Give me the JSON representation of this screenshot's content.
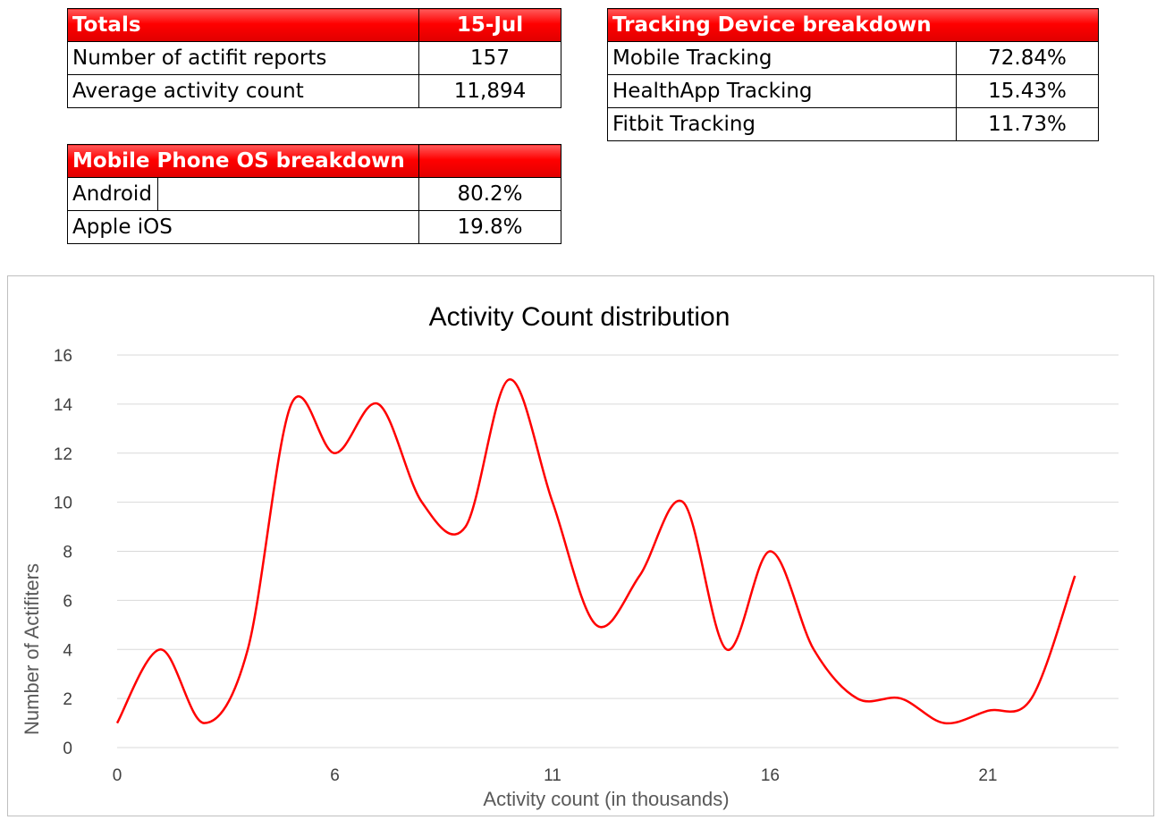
{
  "totals_table": {
    "header": [
      "Totals",
      "15-Jul"
    ],
    "rows": [
      [
        "Number of actifit reports",
        "157"
      ],
      [
        "Average activity count",
        "11,894"
      ]
    ]
  },
  "os_table": {
    "header": [
      "Mobile Phone OS breakdown",
      ""
    ],
    "rows": [
      [
        "Android",
        "80.2%"
      ],
      [
        "Apple iOS",
        "19.8%"
      ]
    ]
  },
  "device_table": {
    "header": [
      "Tracking Device breakdown"
    ],
    "rows": [
      [
        "Mobile Tracking",
        "72.84%"
      ],
      [
        "HealthApp Tracking",
        "15.43%"
      ],
      [
        "Fitbit Tracking",
        "11.73%"
      ]
    ]
  },
  "colors": {
    "header_red": "#ff0000",
    "line_red": "#ff0000",
    "gridline": "#d9d9d9"
  },
  "chart_data": {
    "type": "line",
    "title": "Activity Count distribution",
    "xlabel": "Activity count (in thousands)",
    "ylabel": "Number of Actifiters",
    "xlim": [
      0,
      23
    ],
    "ylim": [
      0,
      16
    ],
    "x_ticks": [
      "0",
      "6",
      "11",
      "16",
      "21"
    ],
    "x_tick_values": [
      0,
      5,
      10,
      15,
      20
    ],
    "y_ticks": [
      "0",
      "2",
      "4",
      "6",
      "8",
      "10",
      "12",
      "14",
      "16"
    ],
    "grid": true,
    "smooth": true,
    "series": [
      {
        "x": [
          0,
          1,
          2,
          3,
          4,
          5,
          6,
          7,
          8,
          9,
          10,
          11,
          12,
          13,
          14,
          15,
          16,
          17,
          18,
          19,
          20,
          21,
          22
        ],
        "values": [
          1,
          4,
          1,
          4,
          14,
          12,
          14,
          10,
          9,
          15,
          10,
          5,
          7,
          10,
          4,
          8,
          4,
          2,
          2,
          1,
          1.5,
          2,
          7
        ]
      }
    ]
  }
}
